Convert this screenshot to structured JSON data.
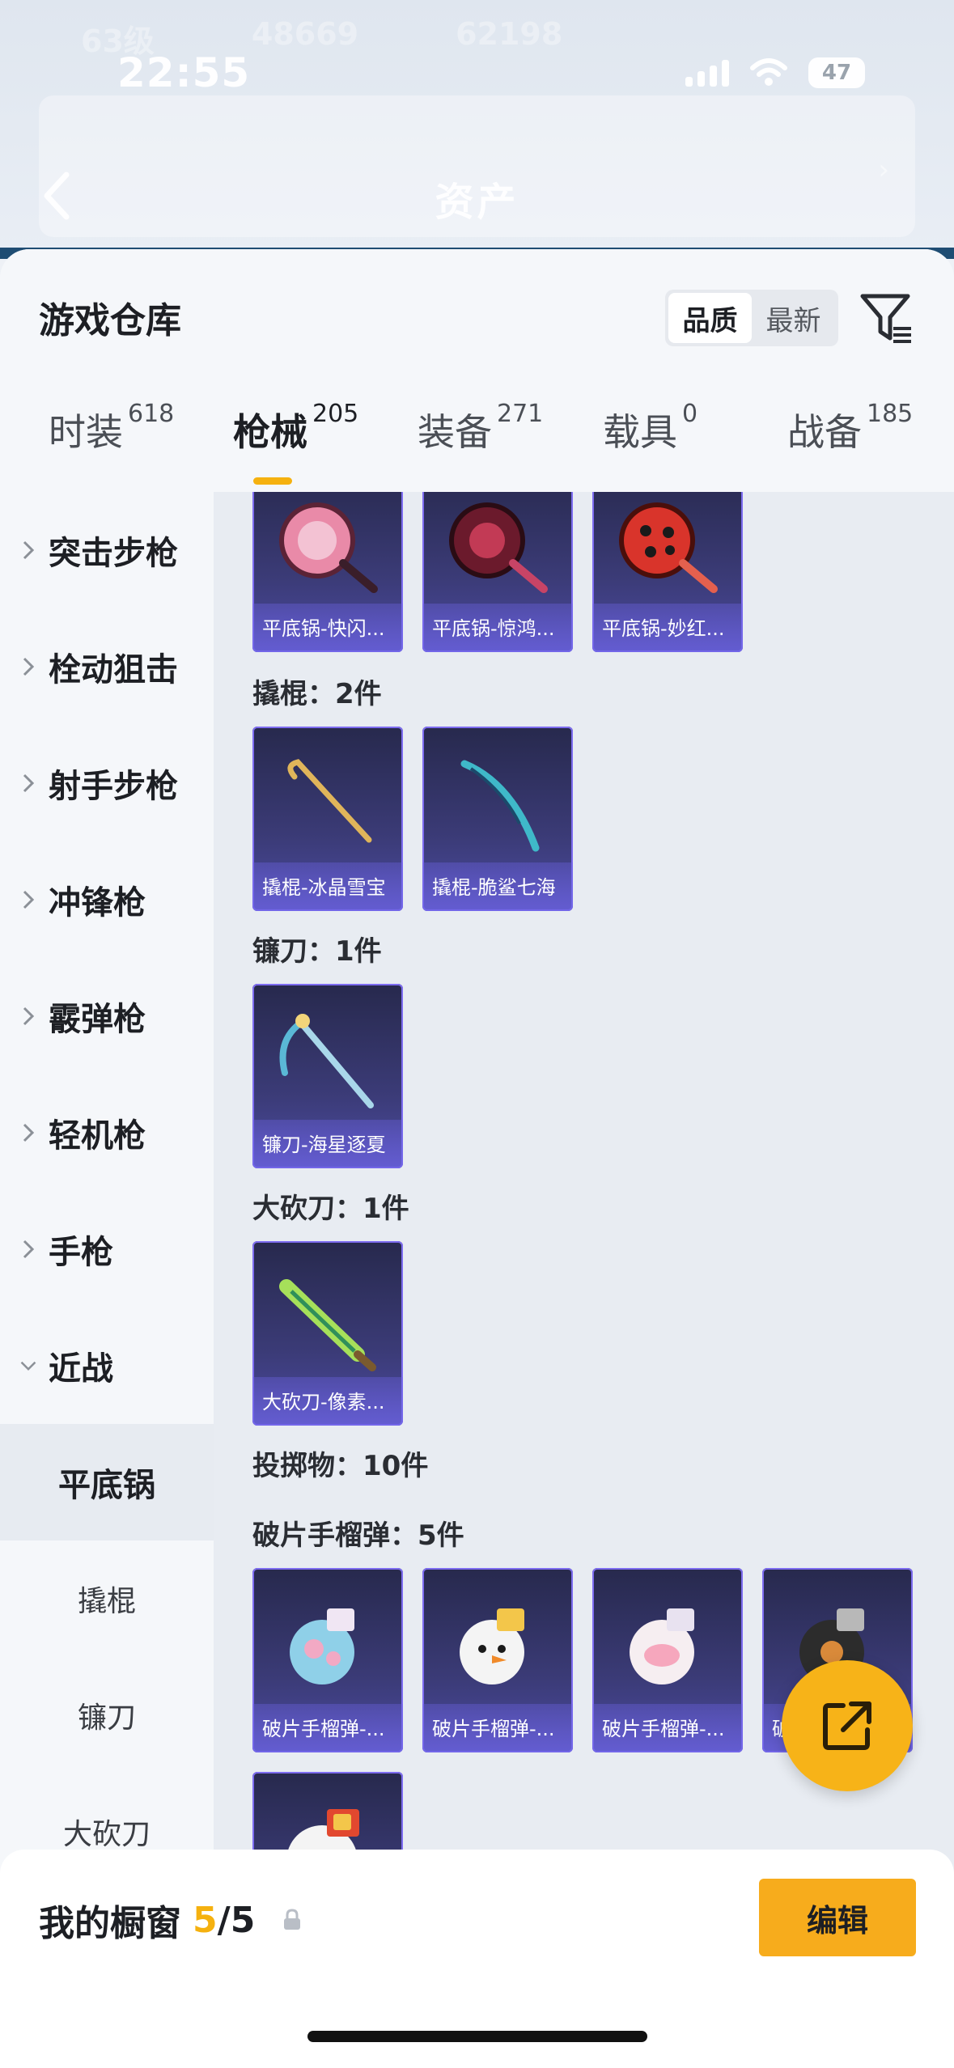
{
  "status_bar": {
    "time": "22:55",
    "battery": "47"
  },
  "background_header": {
    "ghost_texts": [
      "63级",
      "48669",
      "62198"
    ],
    "title": "资产"
  },
  "sheet": {
    "title": "游戏仓库",
    "sort": {
      "options": [
        "品质",
        "最新"
      ],
      "active": "品质"
    },
    "tabs": [
      {
        "label": "时装",
        "count": "618"
      },
      {
        "label": "枪械",
        "count": "205",
        "active": true
      },
      {
        "label": "装备",
        "count": "271"
      },
      {
        "label": "载具",
        "count": "0"
      },
      {
        "label": "战备",
        "count": "185"
      }
    ]
  },
  "sidebar": {
    "categories": [
      "突击步枪",
      "栓动狙击",
      "射手步枪",
      "冲锋枪",
      "霰弹枪",
      "轻机枪",
      "手枪",
      "近战"
    ],
    "subcategories": [
      "平底锅",
      "撬棍",
      "镰刀",
      "大砍刀"
    ],
    "active_subcategory": "平底锅"
  },
  "content": {
    "pan_items": [
      "平底锅-快闪...",
      "平底锅-惊鸿...",
      "平底锅-妙红..."
    ],
    "crowbar_label": "撬棍：2件",
    "crowbar_items": [
      "撬棍-冰晶雪宝",
      "撬棍-脆鲨七海"
    ],
    "sickle_label": "镰刀：1件",
    "sickle_items": [
      "镰刀-海星逐夏"
    ],
    "machete_label": "大砍刀：1件",
    "machete_items": [
      "大砍刀-像素..."
    ],
    "throwables_label": "投掷物：10件",
    "grenade_label": "破片手榴弹：5件",
    "grenade_items": [
      "破片手榴弹-...",
      "破片手榴弹-...",
      "破片手榴弹-...",
      "破"
    ]
  },
  "bottom_bar": {
    "label": "我的橱窗",
    "current": "5",
    "separator": "/",
    "max": "5",
    "edit_label": "编辑"
  },
  "colors": {
    "accent": "#f5b10f",
    "card_bg": "#3b3b77"
  },
  "icons": [
    "back-icon",
    "wifi-icon",
    "signal-icon",
    "filter-icon",
    "chevron-right-icon",
    "chevron-down-icon",
    "share-icon",
    "lock-icon"
  ]
}
